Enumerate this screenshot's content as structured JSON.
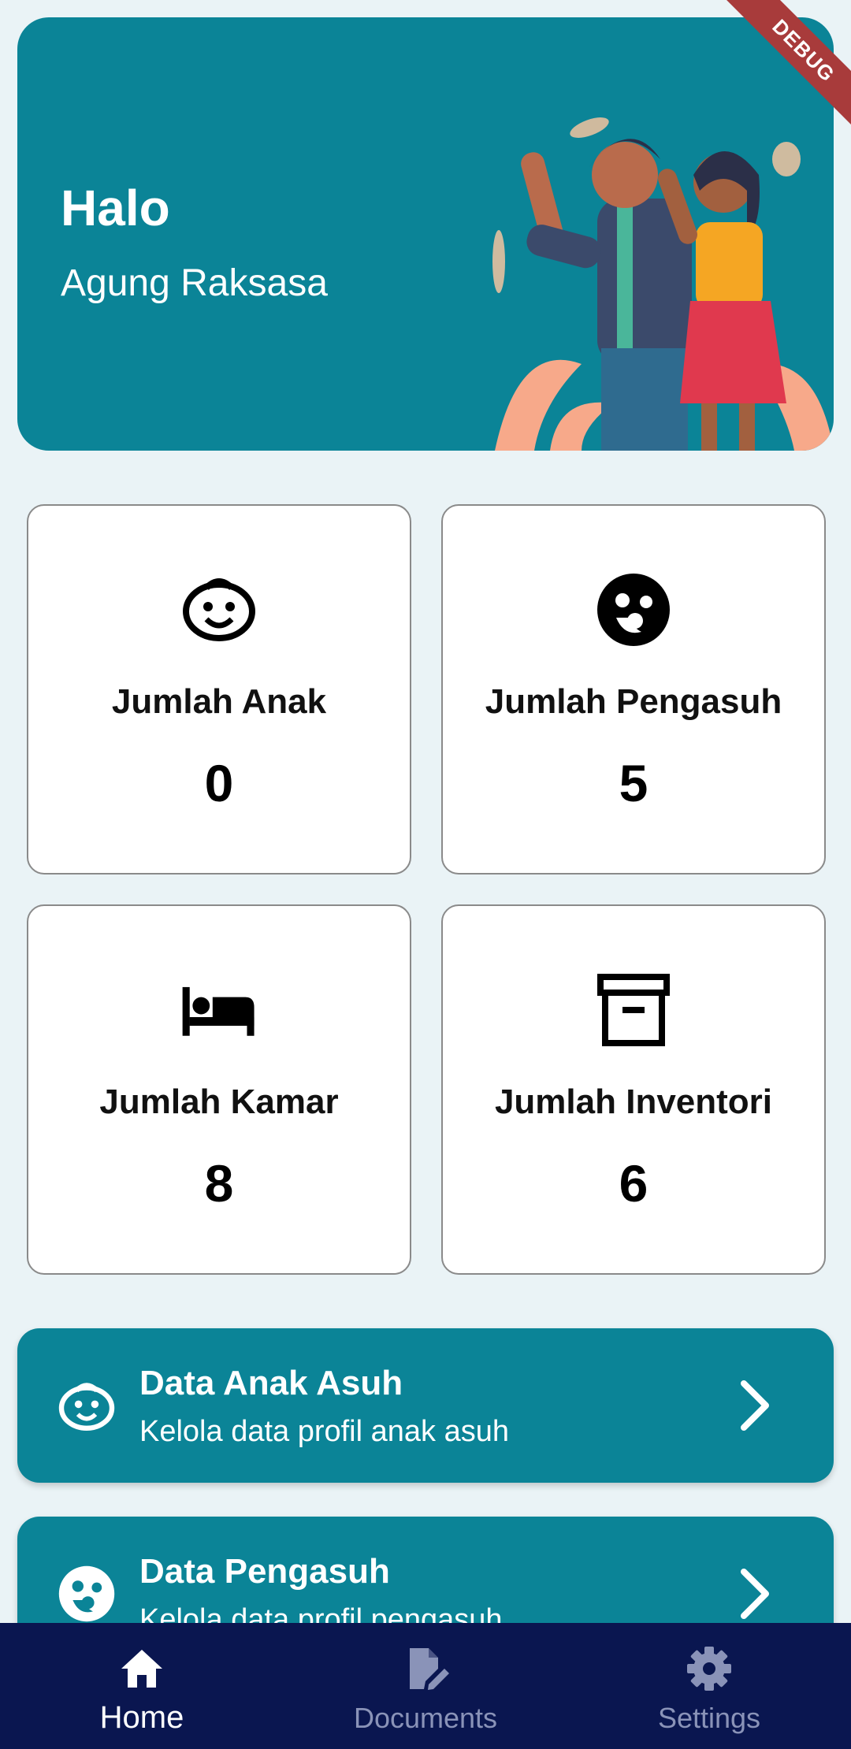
{
  "header": {
    "greeting": "Halo",
    "username": "Agung Raksasa"
  },
  "debug_banner": "DEBUG",
  "stats": [
    {
      "label": "Jumlah Anak",
      "value": "0",
      "icon": "child-face-icon"
    },
    {
      "label": "Jumlah Pengasuh",
      "value": "5",
      "icon": "caregiver-icon"
    },
    {
      "label": "Jumlah Kamar",
      "value": "8",
      "icon": "bed-icon"
    },
    {
      "label": "Jumlah Inventori",
      "value": "6",
      "icon": "archive-box-icon"
    }
  ],
  "menu": [
    {
      "title": "Data Anak Asuh",
      "subtitle": "Kelola data profil anak asuh",
      "icon": "child-face-icon"
    },
    {
      "title": "Data Pengasuh",
      "subtitle": "Kelola data profil pengasuh",
      "icon": "caregiver-icon"
    }
  ],
  "bottom_nav": [
    {
      "label": "Home",
      "icon": "home-icon",
      "active": true
    },
    {
      "label": "Documents",
      "icon": "document-edit-icon",
      "active": false
    },
    {
      "label": "Settings",
      "icon": "gear-icon",
      "active": false
    }
  ],
  "colors": {
    "primary": "#0b8497",
    "background": "#eaf3f6",
    "nav_bg": "#0a1650",
    "nav_inactive": "#8a93b8"
  }
}
